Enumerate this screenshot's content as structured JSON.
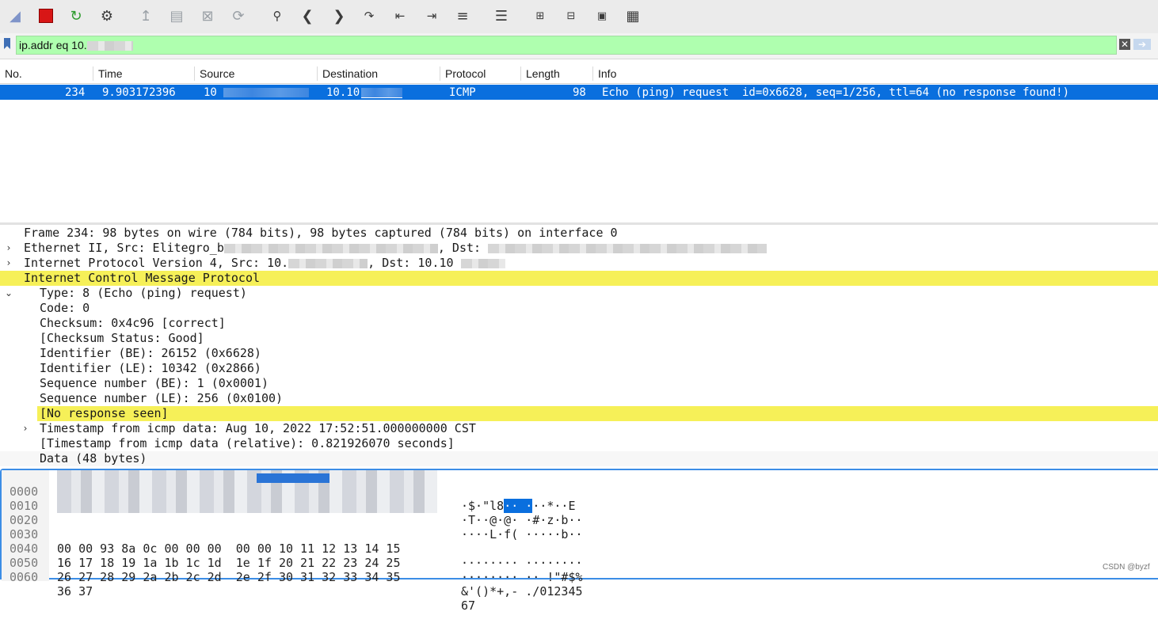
{
  "toolbar": {
    "icons": [
      "shark-fin-icon",
      "stop-capture-icon",
      "restart-capture-icon",
      "capture-options-icon",
      "open-file-icon",
      "save-file-icon",
      "close-file-icon",
      "reload-file-icon",
      "find-packet-icon",
      "go-back-icon",
      "go-forward-icon",
      "go-to-packet-icon",
      "first-packet-icon",
      "last-packet-icon",
      "auto-scroll-icon",
      "colorize-icon",
      "zoom-in-icon",
      "zoom-out-icon",
      "normal-size-icon",
      "resize-columns-icon"
    ]
  },
  "filter": {
    "value": "ip.addr eq 10."
  },
  "packet_list": {
    "columns": [
      "No.",
      "Time",
      "Source",
      "Destination",
      "Protocol",
      "Length",
      "Info"
    ],
    "selected_row": {
      "no": "234",
      "time": "9.903172396",
      "source": "10",
      "destination": "10.10",
      "protocol": "ICMP",
      "length": "98",
      "info": "Echo (ping) request  id=0x6628, seq=1/256, ttl=64 (no response found!)"
    }
  },
  "details": {
    "frame": "Frame 234: 98 bytes on wire (784 bits), 98 bytes captured (784 bits) on interface 0",
    "ethernet_prefix": "Ethernet II, Src: Elitegro_b",
    "ethernet_mid": ", Dst:",
    "ip_prefix": "Internet Protocol Version 4, Src: 10.",
    "ip_mid": ", Dst: 10.10",
    "icmp": "Internet Control Message Protocol",
    "type": "Type: 8 (Echo (ping) request)",
    "code": "Code: 0",
    "checksum": "Checksum: 0x4c96 [correct]",
    "checksum_status": "[Checksum Status: Good]",
    "identifier_be": "Identifier (BE): 26152 (0x6628)",
    "identifier_le": "Identifier (LE): 10342 (0x2866)",
    "seq_be": "Sequence number (BE): 1 (0x0001)",
    "seq_le": "Sequence number (LE): 256 (0x0100)",
    "no_response": "[No response seen]",
    "timestamp": "Timestamp from icmp data: Aug 10, 2022 17:52:51.000000000 CST",
    "timestamp_rel": "[Timestamp from icmp data (relative): 0.821926070 seconds]",
    "data": "Data (48 bytes)"
  },
  "bytes": {
    "offsets": [
      "0000",
      "0010",
      "0020",
      "0030",
      "0040",
      "0050",
      "0060"
    ],
    "row0_ascii_a": "·$·\"l8",
    "row0_ascii_sel": "·· ·",
    "row0_ascii_b": "··*··E",
    "row1_ascii": "·T··@·@· ·#·z·b··",
    "row2_ascii": "····L·f( ·····b··",
    "row3_hex": "00 00 93 8a 0c 00 00 00  00 00 10 11 12 13 14 15",
    "row3_ascii": "········ ········",
    "row4_hex": "16 17 18 19 1a 1b 1c 1d  1e 1f 20 21 22 23 24 25",
    "row4_ascii": "········ ·· !\"#$%",
    "row5_hex": "26 27 28 29 2a 2b 2c 2d  2e 2f 30 31 32 33 34 35",
    "row5_ascii": "&'()*+,- ./012345",
    "row6_hex": "36 37",
    "row6_ascii": "67"
  },
  "watermark": "CSDN @byzf"
}
